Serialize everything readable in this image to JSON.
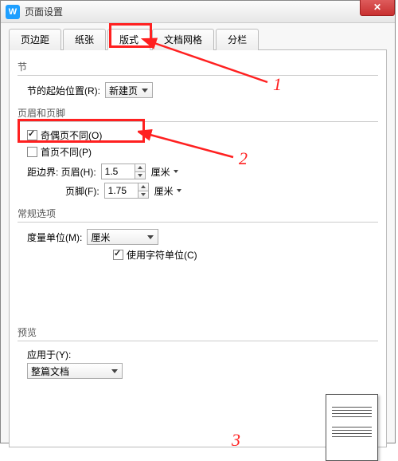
{
  "titlebar": {
    "title": "页面设置",
    "app_icon": "W"
  },
  "tabs": {
    "items": [
      {
        "label": "页边距"
      },
      {
        "label": "纸张"
      },
      {
        "label": "版式"
      },
      {
        "label": "文档网格"
      },
      {
        "label": "分栏"
      }
    ],
    "active_index": 2
  },
  "section": {
    "jie": "节",
    "start_label": "节的起始位置(R):",
    "start_value": "新建页",
    "hf": "页眉和页脚",
    "odd_even": "奇偶页不同(O)",
    "first_diff": "首页不同(P)",
    "edge_header_label": "距边界: 页眉(H):",
    "edge_header_value": "1.5",
    "footer_label": "页脚(F):",
    "footer_value": "1.75",
    "unit_cm": "厘米",
    "general": "常规选项",
    "measure_label": "度量单位(M):",
    "measure_value": "厘米",
    "char_unit": "使用字符单位(C)",
    "preview": "预览",
    "apply_to_label": "应用于(Y):",
    "apply_to_value": "整篇文档"
  },
  "annotations": {
    "a1": "1",
    "a2": "2",
    "a3": "3"
  }
}
